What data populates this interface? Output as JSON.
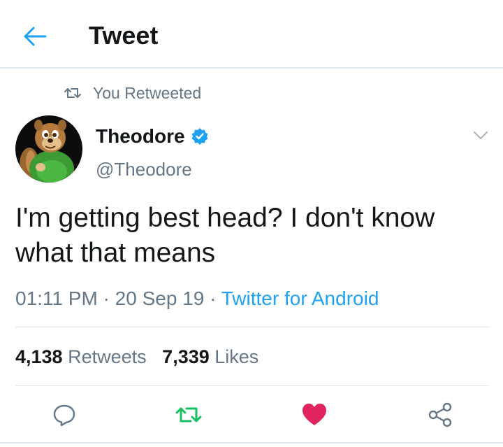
{
  "header": {
    "title": "Tweet"
  },
  "retweet_context": {
    "text": "You Retweeted"
  },
  "author": {
    "name": "Theodore",
    "handle": "@Theodore"
  },
  "tweet": {
    "text": "I'm getting best head? I don't know what that means",
    "time": "01:11 PM",
    "date": "20 Sep 19",
    "source": "Twitter for Android"
  },
  "stats": {
    "retweets_count": "4,138",
    "retweets_label": "Retweets",
    "likes_count": "7,339",
    "likes_label": "Likes"
  },
  "actions": {
    "reply_icon": "reply-icon",
    "retweet_icon": "retweet-icon",
    "like_icon": "heart-icon",
    "share_icon": "share-icon"
  },
  "colors": {
    "accent": "#1da1f2",
    "retweet_green": "#17bf63",
    "like_red": "#e0245e",
    "secondary_text": "#657786",
    "divider": "#e1e8ed"
  }
}
